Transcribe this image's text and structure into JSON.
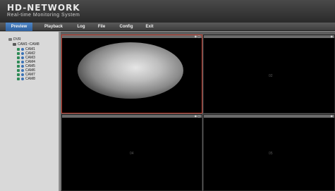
{
  "header": {
    "brand": "HD-NETWORK",
    "subtitle": "Real-time Monitoring System"
  },
  "nav": {
    "items": [
      "Preview",
      "Playback",
      "Log",
      "File",
      "Config",
      "Exit"
    ],
    "active": "Preview"
  },
  "tree": {
    "root": "DVR",
    "group": "CAM1~CAM8",
    "cameras": [
      "CAM1",
      "CAM2",
      "CAM3",
      "CAM4",
      "CAM5",
      "CAM6",
      "CAM7",
      "CAM8"
    ]
  },
  "grid": {
    "cells": [
      {
        "label": ""
      },
      {
        "label": "02"
      },
      {
        "label": "04"
      },
      {
        "label": "05"
      }
    ],
    "selected_cell": 1
  },
  "colors": {
    "accent": "#2d5f9d",
    "selected_border": "#c0392b"
  },
  "icons": {
    "cell_bar": "record-snapshot-icon",
    "camera": "camera-icon",
    "preview": "eye-icon"
  }
}
